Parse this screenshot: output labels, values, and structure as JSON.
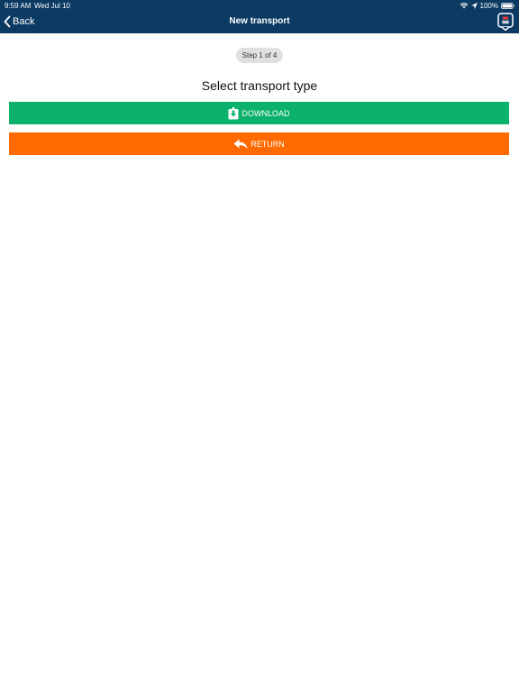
{
  "status_bar": {
    "time": "9:59 AM",
    "date": "Wed Jul 10",
    "battery": "100%",
    "icons": [
      "wifi-icon",
      "location-arrow-icon",
      "battery-icon"
    ]
  },
  "nav_bar": {
    "back_label": "Back",
    "title": "New transport",
    "right_icon": "app-badge-icon"
  },
  "wizard": {
    "step_label": "Step 1 of 4",
    "title": "Select transport type",
    "options": [
      {
        "label": "DOWNLOAD",
        "icon": "download-icon",
        "color": "#0cb16b"
      },
      {
        "label": "RETURN",
        "icon": "reply-arrow-icon",
        "color": "#ff6b00"
      }
    ]
  },
  "colors": {
    "nav_background": "#0b3a63",
    "download": "#0cb16b",
    "return": "#ff6b00",
    "step_pill": "#e0e0e0"
  }
}
